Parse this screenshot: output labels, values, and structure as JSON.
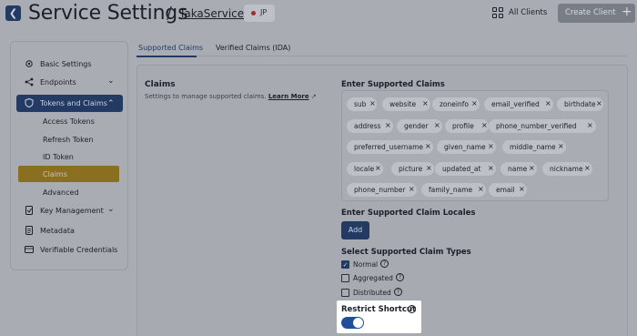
{
  "header": {
    "title": "Service Settings",
    "separator": "/",
    "service_name": "TakaService",
    "region": "JP",
    "all_clients_label": "All Clients",
    "create_client_label": "Create Client"
  },
  "sidebar": {
    "items": [
      {
        "label": "Basic Settings",
        "icon": "gear-icon"
      },
      {
        "label": "Endpoints",
        "icon": "share-icon"
      },
      {
        "label": "Tokens and Claims",
        "icon": "shield-icon"
      },
      {
        "label": "Key Management",
        "icon": "key-icon"
      },
      {
        "label": "Metadata",
        "icon": "document-icon"
      },
      {
        "label": "Verifiable Credentials",
        "icon": "credential-icon"
      }
    ],
    "sub_items": [
      "Access Tokens",
      "Refresh Token",
      "ID Token",
      "Claims",
      "Advanced"
    ]
  },
  "tabs": [
    "Supported Claims",
    "Verified Claims (IDA)"
  ],
  "claims_section": {
    "title": "Claims",
    "description": "Settings to manage supported claims.",
    "learn_more": "Learn More"
  },
  "supported_claims": {
    "label": "Enter Supported Claims",
    "chips": [
      "sub",
      "website",
      "zoneinfo",
      "email_verified",
      "birthdate",
      "address",
      "gender",
      "profile",
      "phone_number_verified",
      "preferred_username",
      "given_name",
      "middle_name",
      "locale",
      "picture",
      "updated_at",
      "name",
      "nickname",
      "phone_number",
      "family_name",
      "email"
    ]
  },
  "claim_locales": {
    "label": "Enter Supported Claim Locales",
    "add_label": "Add"
  },
  "claim_types": {
    "label": "Select Supported Claim Types",
    "options": [
      {
        "label": "Normal",
        "checked": true
      },
      {
        "label": "Aggregated",
        "checked": false
      },
      {
        "label": "Distributed",
        "checked": false
      }
    ]
  },
  "restrict_shortcut": {
    "label": "Restrict Shortcut",
    "enabled": true
  },
  "colors": {
    "primary": "#233a63",
    "active_subitem": "#8b6f20",
    "toggle_on": "#1f4f9a"
  }
}
